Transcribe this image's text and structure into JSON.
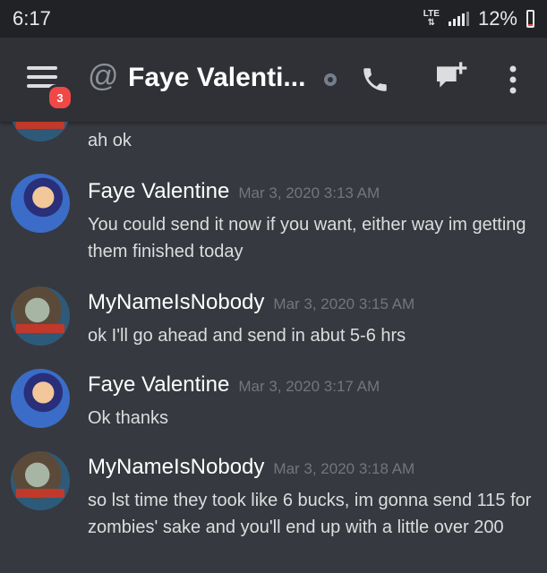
{
  "status_bar": {
    "time": "6:17",
    "network": "LTE",
    "battery": "12%",
    "battery_level_percent": 12
  },
  "header": {
    "unread_badge": "3",
    "at_symbol": "@",
    "title": "Faye Valenti...",
    "icons": {
      "menu": "hamburger-icon",
      "status": "presence-offline-icon",
      "call": "phone-icon",
      "video": "video-call-icon",
      "more": "more-vertical-icon"
    }
  },
  "messages": [
    {
      "author": "",
      "timestamp": "",
      "text": "ah ok",
      "avatar": "mynameisnobody-avatar"
    },
    {
      "author": "Faye Valentine",
      "timestamp": "Mar 3, 2020 3:13 AM",
      "text": "You could send it now if you want, either way im getting them finished today",
      "avatar": "faye-avatar"
    },
    {
      "author": "MyNameIsNobody",
      "timestamp": "Mar 3, 2020 3:15 AM",
      "text": "ok I'll go ahead and send in abut 5-6 hrs",
      "avatar": "mynameisnobody-avatar"
    },
    {
      "author": "Faye Valentine",
      "timestamp": "Mar 3, 2020 3:17 AM",
      "text": "Ok thanks",
      "avatar": "faye-avatar"
    },
    {
      "author": "MyNameIsNobody",
      "timestamp": "Mar 3, 2020 3:18 AM",
      "text": "so lst time they took like 6 bucks, im gonna send 115 for zombies' sake and you'll end up with a little over 200",
      "avatar": "mynameisnobody-avatar"
    }
  ],
  "colors": {
    "background": "#36393f",
    "header": "#2f3136",
    "status_bar": "#202225",
    "badge": "#f04747",
    "timestamp": "#72767d"
  }
}
